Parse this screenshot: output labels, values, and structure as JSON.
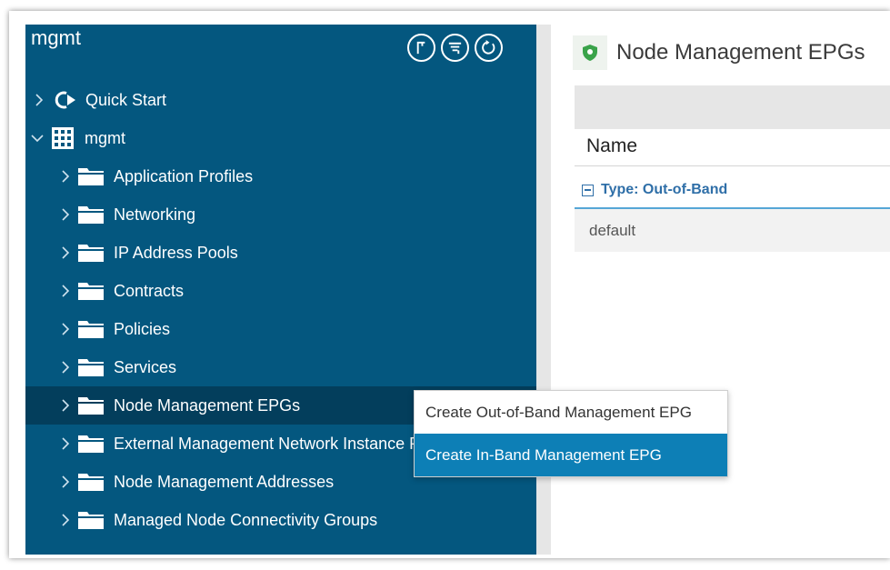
{
  "nav": {
    "title": "mgmt",
    "tools": [
      {
        "icon": "tree-view-icon"
      },
      {
        "icon": "filter-list-icon"
      },
      {
        "icon": "refresh-icon"
      }
    ],
    "items": [
      {
        "label": "Quick Start",
        "icon": "quick-start-icon",
        "expanded": false,
        "level": 0
      },
      {
        "label": "mgmt",
        "icon": "tenant-grid-icon",
        "expanded": true,
        "level": 0
      },
      {
        "label": "Application Profiles",
        "icon": "folder-icon",
        "level": 1
      },
      {
        "label": "Networking",
        "icon": "folder-icon",
        "level": 1
      },
      {
        "label": "IP Address Pools",
        "icon": "folder-icon",
        "level": 1
      },
      {
        "label": "Contracts",
        "icon": "folder-icon",
        "level": 1
      },
      {
        "label": "Policies",
        "icon": "folder-icon",
        "level": 1
      },
      {
        "label": "Services",
        "icon": "folder-icon",
        "level": 1
      },
      {
        "label": "Node Management EPGs",
        "icon": "folder-icon",
        "level": 1,
        "selected": true
      },
      {
        "label": "External Management Network Instance Profiles",
        "icon": "folder-icon",
        "level": 1
      },
      {
        "label": "Node Management Addresses",
        "icon": "folder-icon",
        "level": 1
      },
      {
        "label": "Managed Node Connectivity Groups",
        "icon": "folder-icon",
        "level": 1
      }
    ]
  },
  "content": {
    "title": "Node Management EPGs",
    "title_icon": "shield-icon",
    "table": {
      "column_name": "Name",
      "group_label": "Type: Out-of-Band",
      "rows": [
        "default"
      ]
    }
  },
  "context_menu": {
    "items": [
      {
        "label": "Create Out-of-Band Management EPG",
        "active": false
      },
      {
        "label": "Create In-Band Management EPG",
        "active": true
      }
    ]
  },
  "colors": {
    "nav_bg": "#04577f",
    "nav_selected": "#033e5c",
    "menu_active": "#0d7fb6",
    "group_text": "#2f6fa8",
    "shield": "#3aa34a"
  }
}
